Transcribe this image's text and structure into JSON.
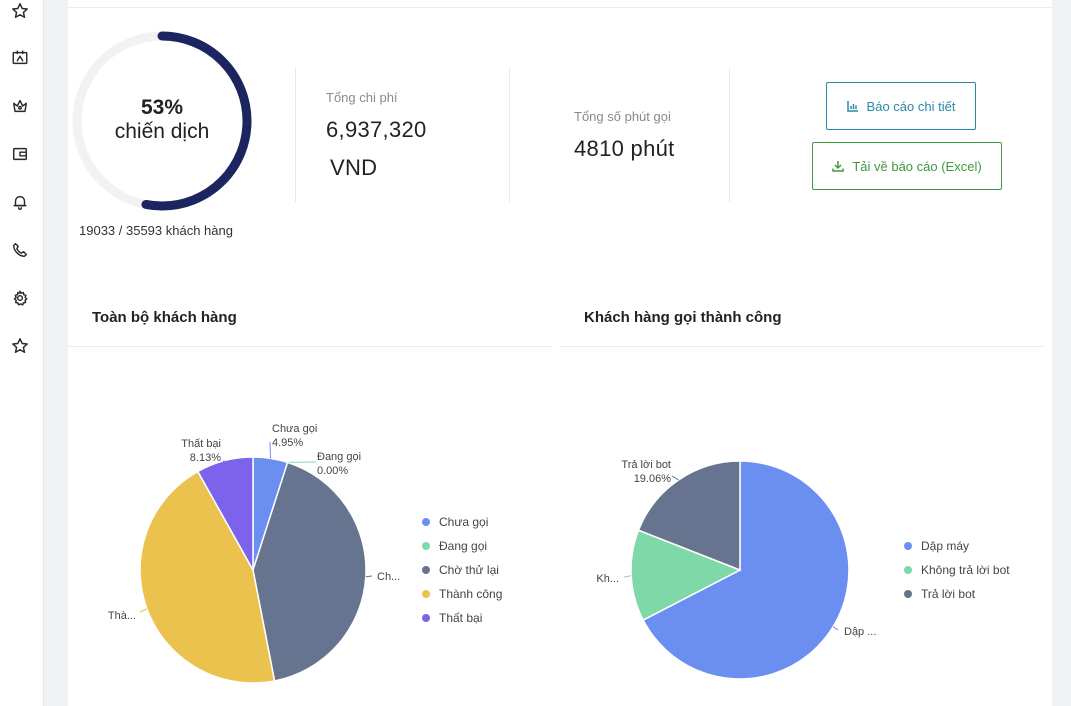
{
  "sidebar": {
    "icons": [
      "star-icon",
      "contact-card-icon",
      "crown-icon",
      "wallet-icon",
      "bell-icon",
      "phone-icon",
      "settings-icon",
      "star-icon"
    ]
  },
  "campaign": {
    "progress_percent": 53,
    "percent_text": "53%",
    "label": "chiến dịch",
    "customers_text": "19033 / 35593 khách hàng",
    "ring_color": "#1d2560"
  },
  "stats": {
    "cost_label": "Tổng chi phí",
    "cost_value": "6,937,320",
    "cost_unit": "VND",
    "minutes_label": "Tổng số phút gọi",
    "minutes_value": "4810 phút"
  },
  "actions": {
    "report_label": "Báo cáo chi tiết",
    "excel_label": "Tải về báo cáo (Excel)"
  },
  "sections": {
    "all_customers_title": "Toàn bộ khách hàng",
    "success_customers_title": "Khách hàng gọi thành công"
  },
  "chart_data": [
    {
      "type": "pie",
      "title": "Toàn bộ khách hàng",
      "categories": [
        "Chưa gọi",
        "Đang gọi",
        "Chờ thử lại",
        "Thành công",
        "Thất bại"
      ],
      "values": [
        4.95,
        0.0,
        42.0,
        44.92,
        8.13
      ],
      "colors": [
        "#6b8ff0",
        "#7fd8a8",
        "#66748f",
        "#ecc24f",
        "#7b63ec"
      ],
      "slice_labels": [
        {
          "name": "Chưa gọi",
          "value": "4.95%"
        },
        {
          "name": "Đang gọi",
          "value": "0.00%"
        },
        {
          "name": "Ch...",
          "value": ""
        },
        {
          "name": "Thà...",
          "value": ""
        },
        {
          "name": "Thất bại",
          "value": "8.13%"
        }
      ],
      "legend_position": "right"
    },
    {
      "type": "pie",
      "title": "Khách hàng gọi thành công",
      "categories": [
        "Dập máy",
        "Không trả lời bot",
        "Trả lời bot"
      ],
      "values": [
        67.4,
        13.54,
        19.06
      ],
      "colors": [
        "#6b8ff0",
        "#7fd8a8",
        "#66748f"
      ],
      "slice_labels": [
        {
          "name": "Dập ...",
          "value": ""
        },
        {
          "name": "Kh...",
          "value": ""
        },
        {
          "name": "Trả lời bot",
          "value": "19.06%"
        }
      ],
      "legend_position": "right"
    }
  ]
}
